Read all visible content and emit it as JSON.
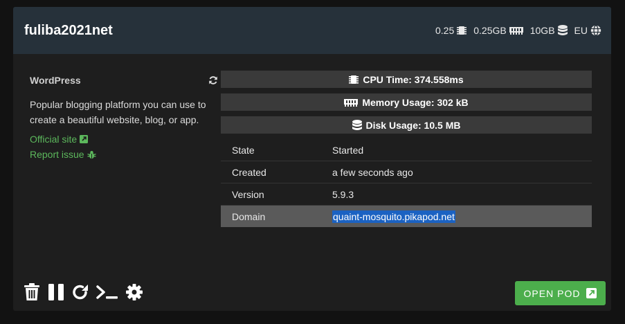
{
  "pod": {
    "name": "fuliba2021net",
    "specs": {
      "cpu": "0.25",
      "cpu_icon": "cpu-chip-icon",
      "memory": "0.25GB",
      "memory_icon": "memory-icon",
      "disk": "10GB",
      "disk_icon": "database-icon",
      "region": "EU",
      "region_icon": "globe-icon"
    }
  },
  "app": {
    "title": "WordPress",
    "refresh_icon": "refresh-icon",
    "description": "Popular blogging platform you can use to create a beautiful website, blog, or app.",
    "official_site": "Official site",
    "official_site_icon": "external-link-icon",
    "report_issue": "Report issue",
    "report_issue_icon": "bug-icon"
  },
  "metrics": {
    "cpu_time": "CPU Time: 374.558ms",
    "memory_usage": "Memory Usage: 302 kB",
    "disk_usage": "Disk Usage: 10.5 MB"
  },
  "info": [
    {
      "key": "State",
      "value": "Started"
    },
    {
      "key": "Created",
      "value": "a few seconds ago"
    },
    {
      "key": "Version",
      "value": "5.9.3"
    },
    {
      "key": "Domain",
      "value": "quaint-mosquito.pikapod.net"
    }
  ],
  "toolbar": {
    "icons": [
      "trash-icon",
      "pause-icon",
      "restart-icon",
      "terminal-icon",
      "settings-gear-icon"
    ]
  },
  "open_button": {
    "label": "OPEN POD",
    "icon": "external-link-icon"
  },
  "colors": {
    "accent_green": "#4cae4c",
    "link_green": "#5cb85c",
    "header_bg": "#26313a",
    "selection": "#1b62c2"
  }
}
